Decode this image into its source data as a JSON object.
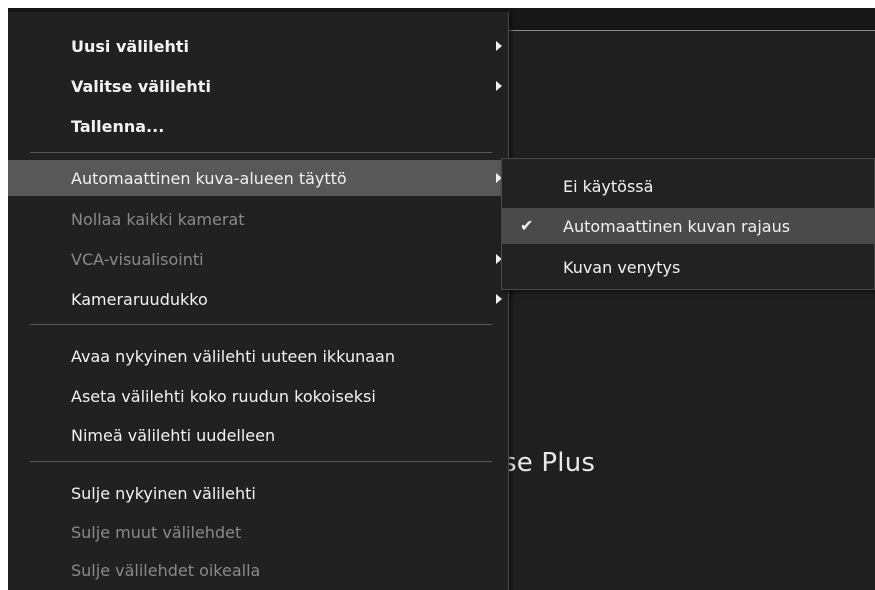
{
  "background": {
    "text": "se Plus"
  },
  "menu": {
    "items": [
      {
        "label": "Uusi välilehti",
        "has_submenu": true,
        "enabled": true
      },
      {
        "label": "Valitse välilehti",
        "has_submenu": true,
        "enabled": true
      },
      {
        "label": "Tallenna...",
        "has_submenu": false,
        "enabled": true
      },
      {
        "label": "Automaattinen kuva-alueen täyttö",
        "has_submenu": true,
        "enabled": true,
        "highlighted": true
      },
      {
        "label": "Nollaa kaikki kamerat",
        "has_submenu": false,
        "enabled": false
      },
      {
        "label": "VCA-visualisointi",
        "has_submenu": true,
        "enabled": false
      },
      {
        "label": "Kameraruudukko",
        "has_submenu": true,
        "enabled": true
      },
      {
        "label": "Avaa nykyinen välilehti uuteen ikkunaan",
        "has_submenu": false,
        "enabled": true
      },
      {
        "label": "Aseta välilehti koko ruudun kokoiseksi",
        "has_submenu": false,
        "enabled": true
      },
      {
        "label": "Nimeä välilehti uudelleen",
        "has_submenu": false,
        "enabled": true
      },
      {
        "label": "Sulje nykyinen välilehti",
        "has_submenu": false,
        "enabled": true
      },
      {
        "label": "Sulje muut välilehdet",
        "has_submenu": false,
        "enabled": false
      },
      {
        "label": "Sulje välilehdet oikealla",
        "has_submenu": false,
        "enabled": false
      }
    ]
  },
  "submenu": {
    "items": [
      {
        "label": "Ei käytössä",
        "checked": false
      },
      {
        "label": "Automaattinen kuvan rajaus",
        "checked": true
      },
      {
        "label": "Kuvan venytys",
        "checked": false
      }
    ],
    "check_glyph": "✔"
  },
  "colors": {
    "menu_bg": "#212121",
    "highlight_bg": "#585858",
    "checked_bg": "#4a4a4a",
    "text": "#f2f2f2",
    "disabled_text": "#8a8a8a"
  }
}
